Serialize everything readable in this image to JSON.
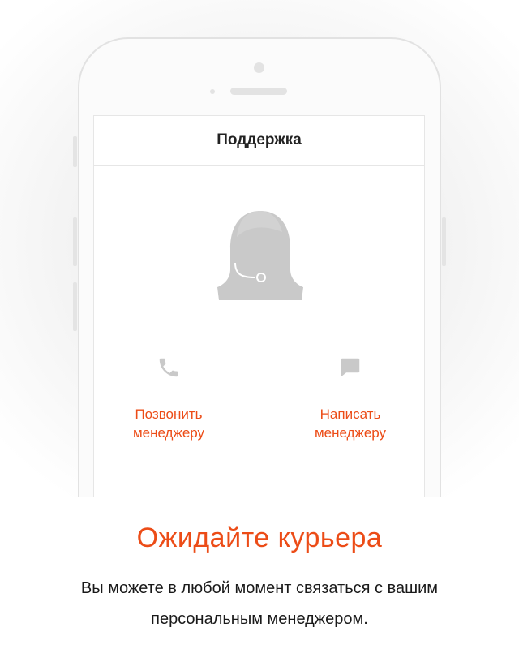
{
  "screen": {
    "title": "Поддержка"
  },
  "actions": {
    "call": {
      "line1": "Позвонить",
      "line2": "менеджеру",
      "icon": "phone-icon"
    },
    "write": {
      "line1": "Написать",
      "line2": "менеджеру",
      "icon": "chat-icon"
    }
  },
  "promo": {
    "headline": "Ожидайте курьера",
    "text_line1": "Вы можете в любой момент связаться с вашим",
    "text_line2": "персональным менеджером."
  },
  "colors": {
    "accent": "#ec4c17",
    "icon_gray": "#c9c9c9",
    "text": "#1a1a1a"
  }
}
